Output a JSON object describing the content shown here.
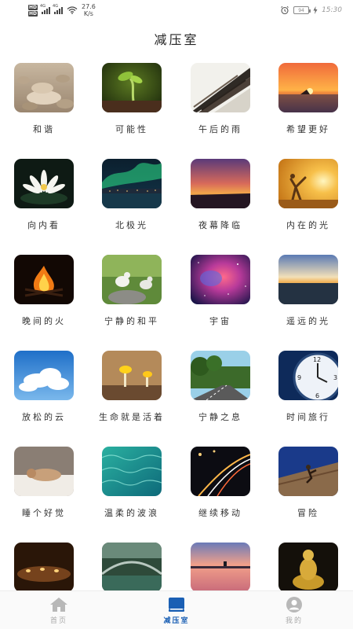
{
  "status_bar": {
    "net_speed_value": "27.6",
    "net_speed_unit": "K/s",
    "battery": "94",
    "time": "15:30",
    "signal_label_1": "4G",
    "signal_label_2": "4G",
    "hd_1": "HD",
    "hd_2": "HD"
  },
  "header": {
    "title": "减压室"
  },
  "items": [
    {
      "label": "和谐",
      "icon": "stones-image"
    },
    {
      "label": "可能性",
      "icon": "sprout-image"
    },
    {
      "label": "午后的雨",
      "icon": "roof-tiles-image"
    },
    {
      "label": "希望更好",
      "icon": "sunset-sea-image"
    },
    {
      "label": "向内看",
      "icon": "lotus-image"
    },
    {
      "label": "北极光",
      "icon": "aurora-image"
    },
    {
      "label": "夜幕降临",
      "icon": "dusk-image"
    },
    {
      "label": "内在的光",
      "icon": "sun-person-image"
    },
    {
      "label": "晚间的火",
      "icon": "campfire-image"
    },
    {
      "label": "宁静的和平",
      "icon": "doves-image"
    },
    {
      "label": "宇宙",
      "icon": "nebula-image"
    },
    {
      "label": "遥远的光",
      "icon": "horizon-light-image"
    },
    {
      "label": "放松的云",
      "icon": "clouds-image"
    },
    {
      "label": "生命就是活着",
      "icon": "mushrooms-image"
    },
    {
      "label": "宁静之息",
      "icon": "road-trees-image"
    },
    {
      "label": "时间旅行",
      "icon": "clock-image"
    },
    {
      "label": "睡个好觉",
      "icon": "sleeping-cat-image"
    },
    {
      "label": "温柔的波浪",
      "icon": "water-image"
    },
    {
      "label": "继续移动",
      "icon": "light-trails-image"
    },
    {
      "label": "冒险",
      "icon": "climber-image"
    },
    {
      "label": "",
      "icon": "candles-image"
    },
    {
      "label": "",
      "icon": "bridge-image"
    },
    {
      "label": "",
      "icon": "lake-sunset-image"
    },
    {
      "label": "",
      "icon": "buddha-image"
    }
  ],
  "bottom_nav": [
    {
      "label": "首页",
      "icon": "home-icon",
      "active": false
    },
    {
      "label": "减压室",
      "icon": "book-icon",
      "active": true
    },
    {
      "label": "我的",
      "icon": "profile-icon",
      "active": false
    }
  ]
}
